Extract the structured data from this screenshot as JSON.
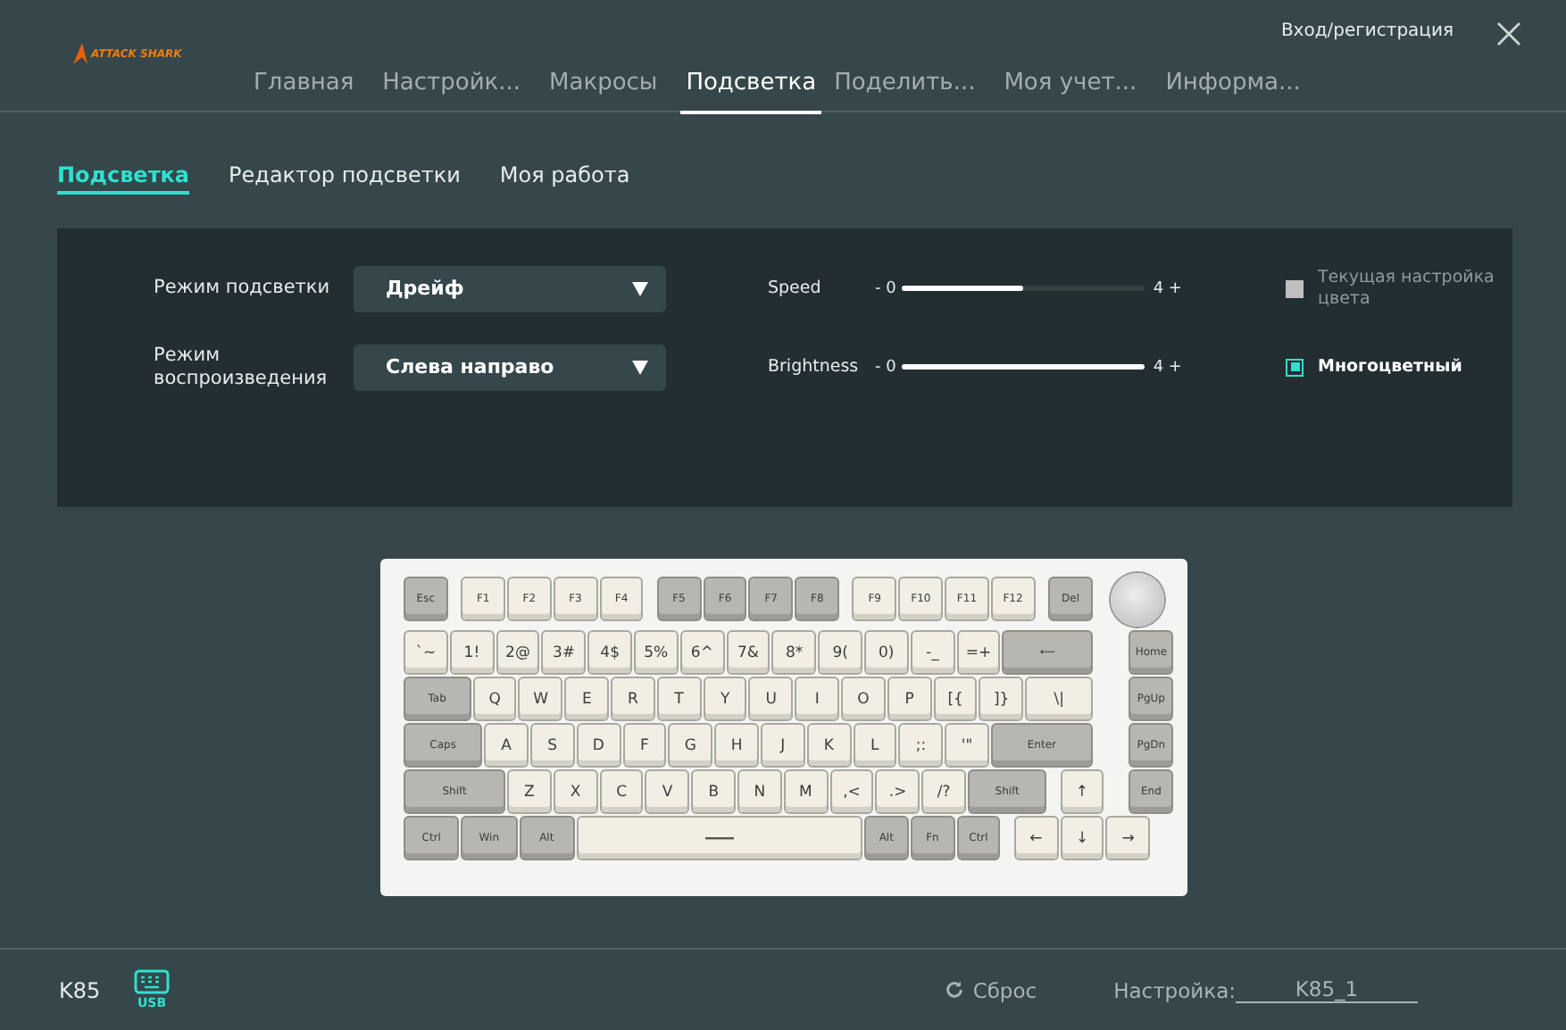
{
  "header": {
    "logo": "ATTACK SHARK",
    "login": "Вход/регистрация",
    "tabs": [
      {
        "label": "Главная",
        "selected": false
      },
      {
        "label": "Настройк...",
        "selected": false
      },
      {
        "label": "Макросы",
        "selected": false
      },
      {
        "label": "Подсветка",
        "selected": true
      },
      {
        "label": "Поделить...",
        "selected": false
      },
      {
        "label": "Моя учет...",
        "selected": false
      },
      {
        "label": "Информа...",
        "selected": false
      }
    ]
  },
  "subtabs": [
    {
      "label": "Подсветка",
      "selected": true
    },
    {
      "label": "Редактор подсветки",
      "selected": false
    },
    {
      "label": "Моя работа",
      "selected": false
    }
  ],
  "settings": {
    "dropdowns": [
      {
        "label": "Режим подсветки",
        "value": "Дрейф"
      },
      {
        "label": "Режим воспроизведения",
        "value": "Слева направо"
      }
    ],
    "sliders": [
      {
        "label": "Speed",
        "min": "- 0",
        "max": "4 +",
        "level": 0.5
      },
      {
        "label": "Brightness",
        "min": "- 0",
        "max": "4 +",
        "level": 1
      }
    ],
    "options": [
      {
        "label": "Текущая настройка цвета",
        "checked": false,
        "disabled": true
      },
      {
        "label": "Многоцветный",
        "checked": true,
        "disabled": false
      }
    ]
  },
  "keyboard": {
    "rows": [
      [
        {
          "label": "Esc",
          "kind": "mod"
        },
        {
          "label": "F1",
          "kind": "alpha"
        },
        {
          "label": "F2",
          "kind": "alpha"
        },
        {
          "label": "F3",
          "kind": "alpha"
        },
        {
          "label": "F4",
          "kind": "alpha"
        },
        {
          "label": "F5",
          "kind": "mod"
        },
        {
          "label": "F6",
          "kind": "mod"
        },
        {
          "label": "F7",
          "kind": "mod"
        },
        {
          "label": "F8",
          "kind": "mod"
        },
        {
          "label": "F9",
          "kind": "alpha"
        },
        {
          "label": "F10",
          "kind": "alpha"
        },
        {
          "label": "F11",
          "kind": "alpha"
        },
        {
          "label": "F12",
          "kind": "alpha"
        },
        {
          "label": "Del",
          "kind": "mod"
        },
        {
          "kind": "knob"
        }
      ],
      [
        {
          "label": "`~",
          "kind": "alpha"
        },
        {
          "label": "1!",
          "kind": "alpha"
        },
        {
          "label": "2@",
          "kind": "alpha"
        },
        {
          "label": "3#",
          "kind": "alpha"
        },
        {
          "label": "4$",
          "kind": "alpha"
        },
        {
          "label": "5%",
          "kind": "alpha"
        },
        {
          "label": "6^",
          "kind": "alpha"
        },
        {
          "label": "7&",
          "kind": "alpha"
        },
        {
          "label": "8*",
          "kind": "alpha"
        },
        {
          "label": "9(",
          "kind": "alpha"
        },
        {
          "label": "0)",
          "kind": "alpha"
        },
        {
          "label": "-_",
          "kind": "alpha"
        },
        {
          "label": "=+",
          "kind": "alpha"
        },
        {
          "label": "⟵",
          "kind": "mod"
        }
      ],
      [
        {
          "label": "Tab",
          "kind": "mod"
        },
        {
          "label": "Q",
          "kind": "alpha"
        },
        {
          "label": "W",
          "kind": "alpha"
        },
        {
          "label": "E",
          "kind": "alpha"
        },
        {
          "label": "R",
          "kind": "alpha"
        },
        {
          "label": "T",
          "kind": "alpha"
        },
        {
          "label": "Y",
          "kind": "alpha"
        },
        {
          "label": "U",
          "kind": "alpha"
        },
        {
          "label": "I",
          "kind": "alpha"
        },
        {
          "label": "O",
          "kind": "alpha"
        },
        {
          "label": "P",
          "kind": "alpha"
        },
        {
          "label": "[{",
          "kind": "alpha"
        },
        {
          "label": "]}",
          "kind": "alpha"
        },
        {
          "label": "\\|",
          "kind": "alpha"
        }
      ],
      [
        {
          "label": "Caps",
          "kind": "mod"
        },
        {
          "label": "A",
          "kind": "alpha"
        },
        {
          "label": "S",
          "kind": "alpha"
        },
        {
          "label": "D",
          "kind": "alpha"
        },
        {
          "label": "F",
          "kind": "alpha"
        },
        {
          "label": "G",
          "kind": "alpha"
        },
        {
          "label": "H",
          "kind": "alpha"
        },
        {
          "label": "J",
          "kind": "alpha"
        },
        {
          "label": "K",
          "kind": "alpha"
        },
        {
          "label": "L",
          "kind": "alpha"
        },
        {
          "label": ";:",
          "kind": "alpha"
        },
        {
          "label": "'\"",
          "kind": "alpha"
        },
        {
          "label": "Enter",
          "kind": "mod"
        }
      ],
      [
        {
          "label": "Shift",
          "kind": "mod"
        },
        {
          "label": "Z",
          "kind": "alpha"
        },
        {
          "label": "X",
          "kind": "alpha"
        },
        {
          "label": "C",
          "kind": "alpha"
        },
        {
          "label": "V",
          "kind": "alpha"
        },
        {
          "label": "B",
          "kind": "alpha"
        },
        {
          "label": "N",
          "kind": "alpha"
        },
        {
          "label": "M",
          "kind": "alpha"
        },
        {
          "label": ",<",
          "kind": "alpha"
        },
        {
          "label": ".>",
          "kind": "alpha"
        },
        {
          "label": "/?",
          "kind": "alpha"
        },
        {
          "label": "Shift",
          "kind": "mod"
        },
        {
          "label": "↑",
          "kind": "alpha"
        }
      ],
      [
        {
          "label": "Ctrl",
          "kind": "mod"
        },
        {
          "label": "Win",
          "kind": "mod"
        },
        {
          "label": "Alt",
          "kind": "mod"
        },
        {
          "kind": "space"
        },
        {
          "label": "Alt",
          "kind": "mod"
        },
        {
          "label": "Fn",
          "kind": "mod"
        },
        {
          "label": "Ctrl",
          "kind": "mod"
        },
        {
          "label": "←",
          "kind": "alpha"
        },
        {
          "label": "↓",
          "kind": "alpha"
        },
        {
          "label": "→",
          "kind": "alpha"
        }
      ]
    ],
    "side_keys": [
      {
        "label": "Home",
        "kind": "mod"
      },
      {
        "label": "PgUp",
        "kind": "mod"
      },
      {
        "label": "PgDn",
        "kind": "mod"
      },
      {
        "label": "End",
        "kind": "mod"
      }
    ]
  },
  "footer": {
    "model": "K85",
    "connection": "USB",
    "reset": "Сброс",
    "profile_label": "Настройка:",
    "profile_value": "K85_1"
  }
}
